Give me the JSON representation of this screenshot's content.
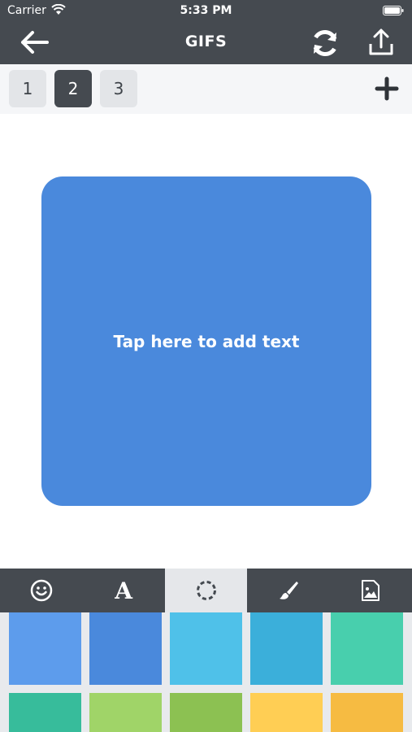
{
  "status_bar": {
    "carrier": "Carrier",
    "time": "5:33 PM"
  },
  "nav": {
    "title": "GIFS"
  },
  "pages": [
    "1",
    "2",
    "3"
  ],
  "active_page": "2",
  "canvas": {
    "hint": "Tap here to add text",
    "color": "#4a89dc"
  },
  "tools": [
    {
      "name": "emoji",
      "icon": "smiley-icon"
    },
    {
      "name": "text",
      "icon": "text-icon",
      "glyph": "A"
    },
    {
      "name": "background",
      "icon": "dashed-circle-icon",
      "active": true
    },
    {
      "name": "brush",
      "icon": "brush-icon"
    },
    {
      "name": "image",
      "icon": "image-icon"
    }
  ],
  "swatch_colors": [
    "#5d9cec",
    "#4a89dc",
    "#4fc1e9",
    "#3bafda",
    "#48cfad",
    "#37bc9b",
    "#a0d468",
    "#8cc152",
    "#ffce54",
    "#f6bb42"
  ]
}
